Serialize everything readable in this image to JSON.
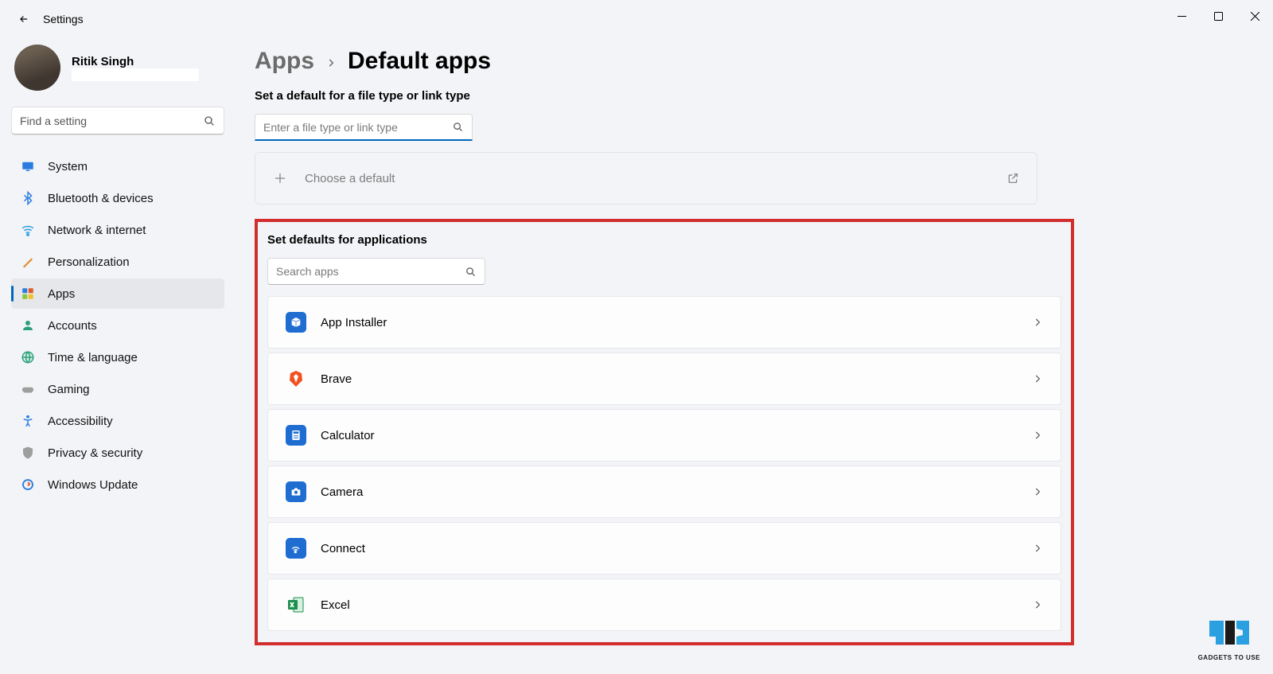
{
  "window": {
    "title": "Settings"
  },
  "profile": {
    "name": "Ritik Singh"
  },
  "sidebarSearch": {
    "placeholder": "Find a setting"
  },
  "nav": {
    "items": [
      {
        "label": "System"
      },
      {
        "label": "Bluetooth & devices"
      },
      {
        "label": "Network & internet"
      },
      {
        "label": "Personalization"
      },
      {
        "label": "Apps"
      },
      {
        "label": "Accounts"
      },
      {
        "label": "Time & language"
      },
      {
        "label": "Gaming"
      },
      {
        "label": "Accessibility"
      },
      {
        "label": "Privacy & security"
      },
      {
        "label": "Windows Update"
      }
    ],
    "activeIndex": 4
  },
  "breadcrumb": {
    "parent": "Apps",
    "current": "Default apps"
  },
  "section1": {
    "title": "Set a default for a file type or link type",
    "searchPlaceholder": "Enter a file type or link type",
    "chooseLabel": "Choose a default"
  },
  "section2": {
    "title": "Set defaults for applications",
    "searchPlaceholder": "Search apps",
    "apps": [
      {
        "label": "App Installer",
        "iconColor": "#1f6dd0",
        "iconKind": "box"
      },
      {
        "label": "Brave",
        "iconColor": "#f25122",
        "iconKind": "shield"
      },
      {
        "label": "Calculator",
        "iconColor": "#1f6dd0",
        "iconKind": "calc"
      },
      {
        "label": "Camera",
        "iconColor": "#1f6dd0",
        "iconKind": "camera"
      },
      {
        "label": "Connect",
        "iconColor": "#1f6dd0",
        "iconKind": "wifi"
      },
      {
        "label": "Excel",
        "iconColor": "#1d8f4e",
        "iconKind": "excel"
      }
    ]
  },
  "watermark": {
    "text": "GADGETS TO USE"
  }
}
